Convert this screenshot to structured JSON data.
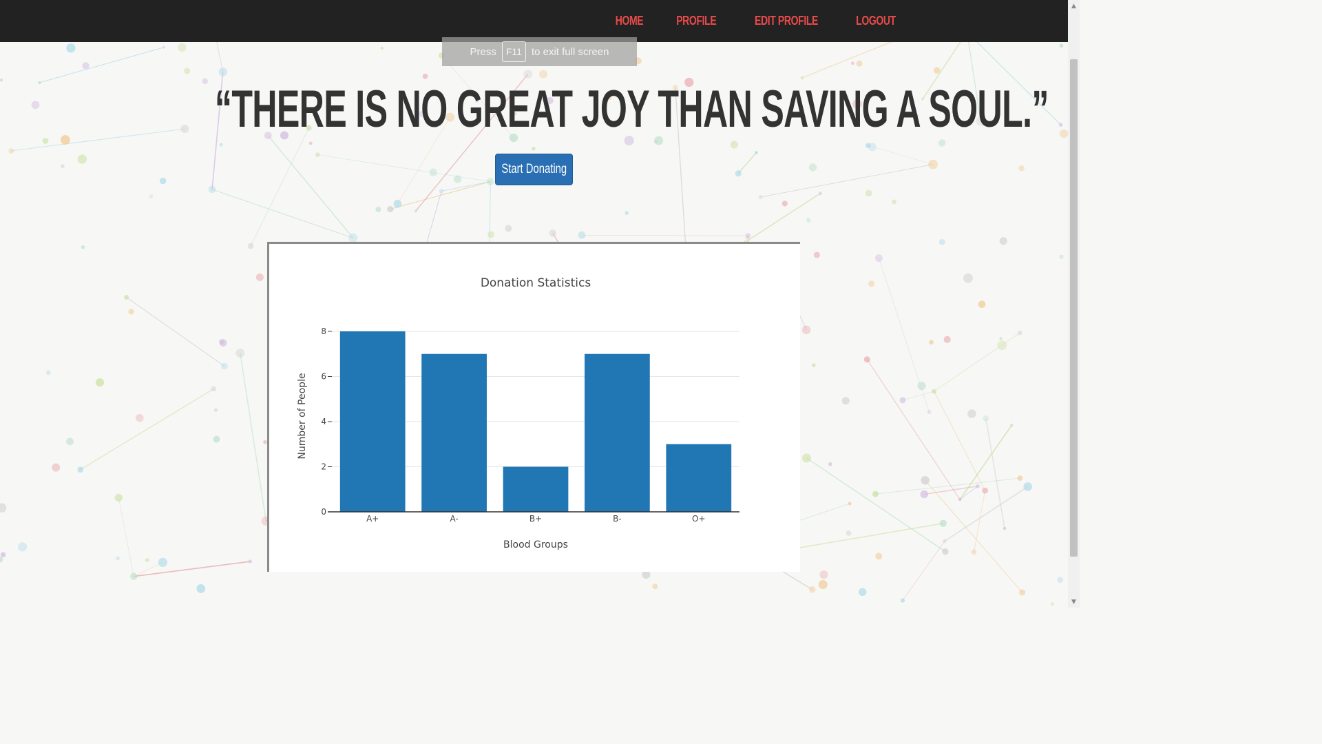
{
  "nav": {
    "items": [
      {
        "label": "HOME"
      },
      {
        "label": "PROFILE"
      },
      {
        "label": "EDIT PROFILE"
      },
      {
        "label": "LOGOUT"
      }
    ],
    "link_color": "#e84a4a",
    "background": "#222222"
  },
  "fullscreen_toast": {
    "prefix": "Press",
    "key": "F11",
    "suffix": "to exit full screen"
  },
  "hero": {
    "quote": "“THERE IS NO GREAT JOY THAN SAVING A SOUL.”",
    "cta_label": "Start Donating"
  },
  "chart_data": {
    "type": "bar",
    "title": "Donation Statistics",
    "xlabel": "Blood Groups",
    "ylabel": "Number of People",
    "categories": [
      "A+",
      "A-",
      "B+",
      "B-",
      "O+"
    ],
    "values": [
      8,
      7,
      2,
      7,
      3
    ],
    "ylim": [
      0,
      8
    ],
    "yticks": [
      0,
      2,
      4,
      6,
      8
    ],
    "bar_color": "#2077b4",
    "grid": true
  },
  "icons": {
    "scroll_up": "scroll-up-arrow-icon",
    "scroll_down": "scroll-down-arrow-icon"
  }
}
